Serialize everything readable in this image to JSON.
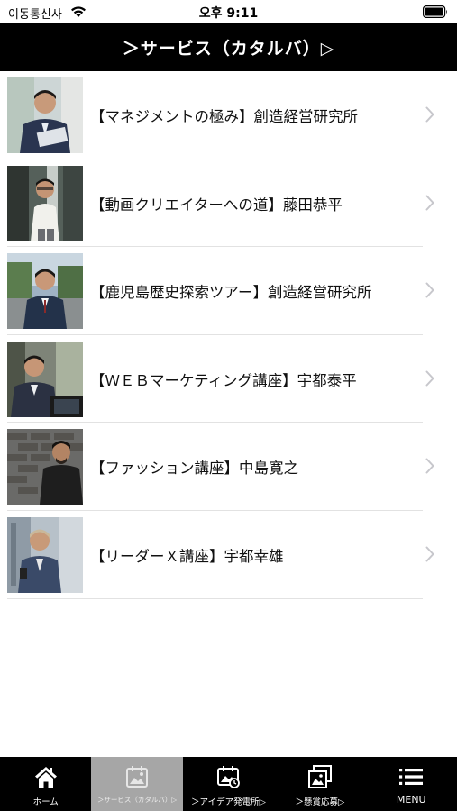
{
  "status_bar": {
    "carrier": "이동통신사",
    "time": "오후 9:11"
  },
  "header": {
    "title": "＞サービス（カタルバ）▷"
  },
  "list": {
    "items": [
      {
        "label": "【マネジメントの極み】創造経営研究所"
      },
      {
        "label": "【動画クリエイターへの道】藤田恭平"
      },
      {
        "label": "【鹿児島歴史探索ツアー】創造経営研究所"
      },
      {
        "label": "【ＷＥＢマーケティング講座】宇都泰平"
      },
      {
        "label": "【ファッション講座】中島寛之"
      },
      {
        "label": "【リーダーＸ講座】宇都幸雄"
      }
    ]
  },
  "tab_bar": {
    "home": "ホーム",
    "service": "＞サービス（カタルバ）▷",
    "idea": "＞アイデア発電所▷",
    "contest": "＞懸賞応募▷",
    "menu": "MENU"
  },
  "colors": {
    "header_bg": "#000000",
    "tab_bg": "#000000",
    "tab_active_bg": "#a6a6a6",
    "chevron": "#c7c7cc"
  }
}
